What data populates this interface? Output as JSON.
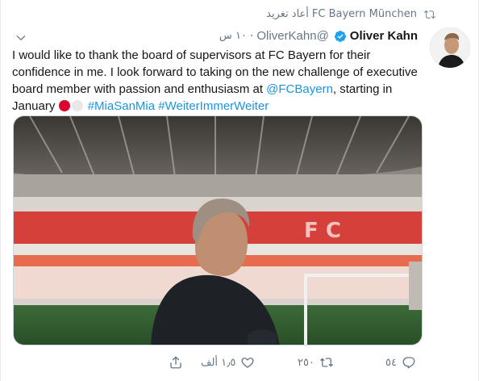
{
  "retweet": {
    "label": "أعاد تغريد",
    "account": "FC Bayern München",
    "icon": "retweet-icon"
  },
  "author": {
    "name": "Oliver Kahn",
    "handle": "@OliverKahn",
    "verified": true,
    "time": "١٠ س"
  },
  "tweet": {
    "text_part1": "I would like to thank the board of supervisors at FC Bayern for their confidence in me. I look forward to taking on the new challenge of executive board member with passion and enthusiasm at ",
    "mention": "@FCBayern",
    "text_part2": ", starting in January ",
    "emoji_colors": [
      "#dc052d",
      "#e8e8e8"
    ],
    "hashtag1": "#MiaSanMia",
    "hashtag2": "#WeiterImmerWeiter"
  },
  "actions": {
    "reply_count": "٥٤",
    "retweet_count": "٢٥٠",
    "like_count": "١٫٥ ألف"
  },
  "colors": {
    "link": "#1b95e0",
    "muted": "#657786",
    "verified": "#1da1f2"
  }
}
